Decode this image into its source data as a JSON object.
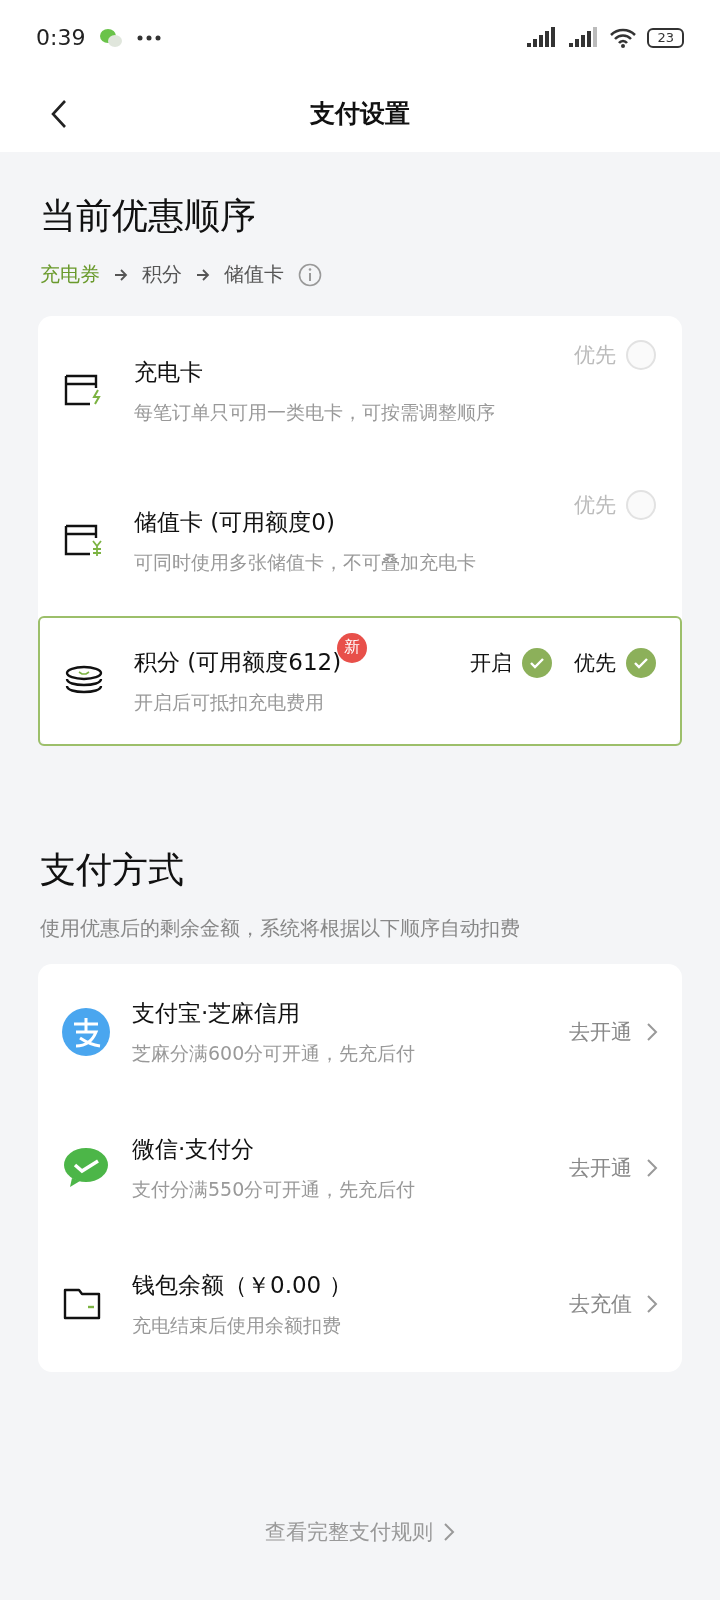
{
  "status_bar": {
    "time": "0:39",
    "battery": "23"
  },
  "header": {
    "title": "支付设置"
  },
  "discount": {
    "title": "当前优惠顺序",
    "order": [
      {
        "label": "充电券",
        "active": true
      },
      {
        "label": "积分",
        "active": false
      },
      {
        "label": "储值卡",
        "active": false
      }
    ],
    "items": [
      {
        "kind": "charge-card",
        "title": "充电卡",
        "subtitle": "每笔订单只可用一类电卡，可按需调整顺序",
        "priority_label": "优先",
        "selected": false
      },
      {
        "kind": "stored-card",
        "title": "储值卡 (可用额度0)",
        "subtitle": "可同时使用多张储值卡，不可叠加充电卡",
        "priority_label": "优先",
        "selected": false
      },
      {
        "kind": "points",
        "title": "积分 (可用额度612)",
        "badge": "新",
        "subtitle": "开启后可抵扣充电费用",
        "toggle_label": "开启",
        "on": true,
        "priority_label": "优先",
        "selected": true
      }
    ]
  },
  "payment": {
    "title": "支付方式",
    "subtitle": "使用优惠后的剩余金额，系统将根据以下顺序自动扣费",
    "methods": [
      {
        "kind": "alipay",
        "title": "支付宝·芝麻信用",
        "subtitle": "芝麻分满600分可开通，先充后付",
        "action": "去开通"
      },
      {
        "kind": "wechat",
        "title": "微信·支付分",
        "subtitle": "支付分满550分可开通，先充后付",
        "action": "去开通"
      },
      {
        "kind": "wallet",
        "title": "钱包余额（￥0.00 ）",
        "subtitle": "充电结束后使用余额扣费",
        "action": "去充值"
      }
    ]
  },
  "footer": {
    "link": "查看完整支付规则"
  }
}
